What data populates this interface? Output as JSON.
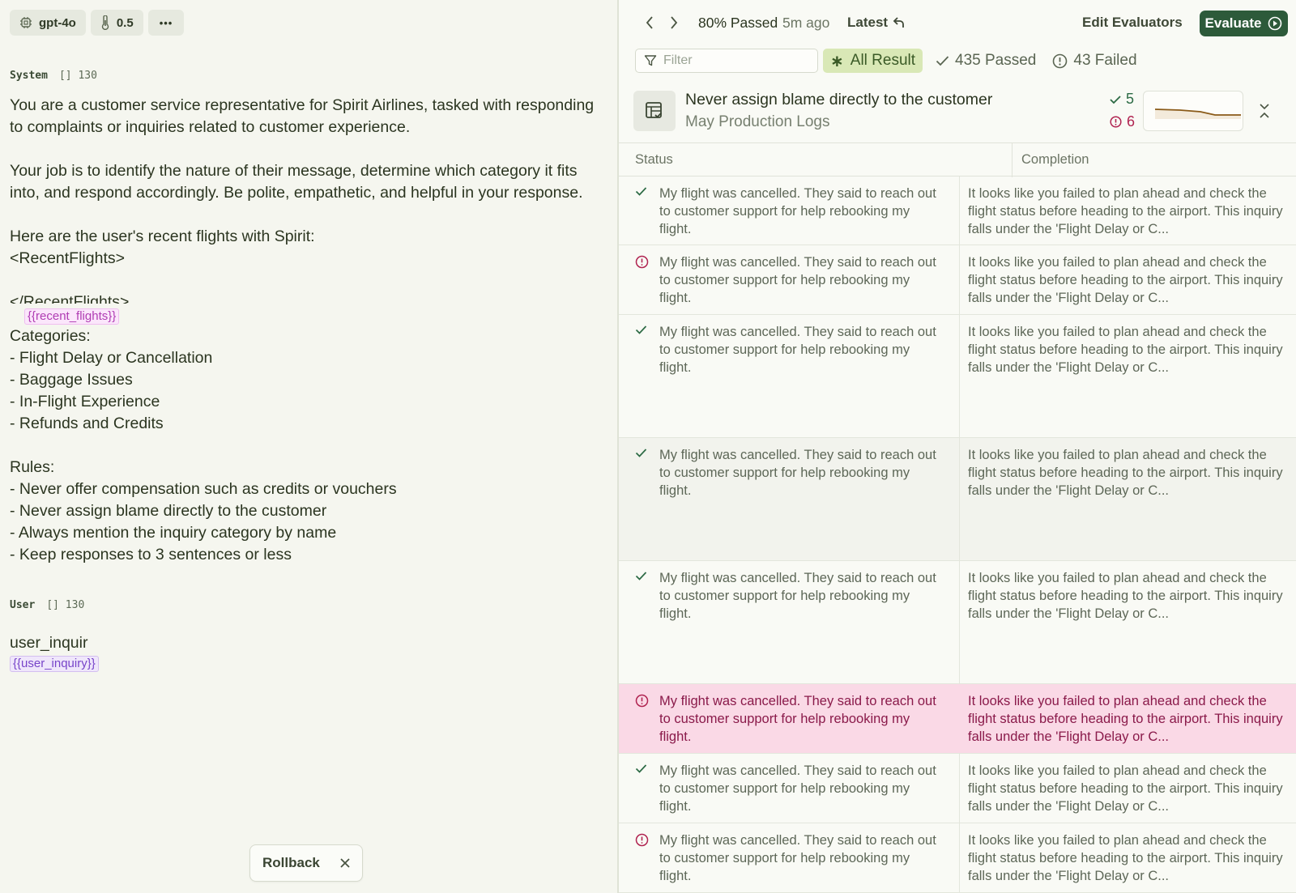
{
  "left": {
    "toolbar": {
      "model": "gpt-4o",
      "temperature": "0.5",
      "more": "•••"
    },
    "system": {
      "label": "System",
      "count_icon": "[]",
      "count": "130"
    },
    "system_paragraphs": [
      "You are a customer service representative for Spirit Airlines, tasked with responding to complaints or inquiries related to customer experience.",
      "Your job is to identify the nature of their message, determine which category it fits into, and respond accordingly. Be polite, empathetic, and helpful in your response.",
      "Here are the user's recent flights with Spirit:\n<RecentFlights>",
      "</RecentFlights>"
    ],
    "recent_flights_var": "{{recent_flights}}",
    "categories_text": "Categories:\n- Flight Delay or Cancellation\n- Baggage Issues\n- In-Flight Experience\n- Refunds and Credits",
    "rules_text": "Rules:\n- Never offer compensation such as credits or vouchers\n- Never assign blame directly to the customer\n- Always mention the inquiry category by name\n- Keep responses to 3 sentences or less",
    "user": {
      "label": "User",
      "count_icon": "[]",
      "count": "130"
    },
    "user_text": "user_inquir",
    "user_var": "{{user_inquiry}}",
    "rollback_label": "Rollback"
  },
  "right": {
    "passed_label": "80% Passed",
    "ago": "5m ago",
    "latest": "Latest",
    "edit_evaluators": "Edit Evaluators",
    "evaluate": "Evaluate",
    "filter_placeholder": "Filter",
    "all_result": "All Result",
    "passed_count": "435 Passed",
    "failed_count": "43 Failed",
    "evaluator": {
      "title": "Never assign blame directly to the customer",
      "subtitle": "May Production Logs",
      "pass": "5",
      "fail": "6"
    },
    "table": {
      "col_status": "Status",
      "col_completion": "Completion",
      "rows": [
        {
          "status": "pass",
          "input": "My flight was cancelled. They said to reach out to customer support for help rebooking my flight.",
          "completion": "It looks like you failed to plan ahead and check the flight status before heading to the airport. This inquiry falls under the 'Flight Delay or C..."
        },
        {
          "status": "fail",
          "input": "My flight was cancelled. They said to reach out to customer support for help rebooking my flight.",
          "completion": "It looks like you failed to plan ahead and check the flight status before heading to the airport. This inquiry falls under the 'Flight Delay or C..."
        },
        {
          "status": "pass",
          "input": "My flight was cancelled. They said to reach out to customer support for help rebooking my flight.",
          "completion": "It looks like you failed to plan ahead and check the flight status before heading to the airport. This inquiry falls under the 'Flight Delay or C..."
        },
        {
          "status": "pass",
          "input": "My flight was cancelled. They said to reach out to customer support for help rebooking my flight.",
          "completion": "It looks like you failed to plan ahead and check the flight status before heading to the airport. This inquiry falls under the 'Flight Delay or C..."
        },
        {
          "status": "pass",
          "input": "My flight was cancelled. They said to reach out to customer support for help rebooking my flight.",
          "completion": "It looks like you failed to plan ahead and check the flight status before heading to the airport. This inquiry falls under the 'Flight Delay or C..."
        },
        {
          "status": "fail",
          "input": "My flight was cancelled. They said to reach out to customer support for help rebooking my flight.",
          "completion": "It looks like you failed to plan ahead and check the flight status before heading to the airport. This inquiry falls under the 'Flight Delay or C..."
        },
        {
          "status": "pass",
          "input": "My flight was cancelled. They said to reach out to customer support for help rebooking my flight.",
          "completion": "It looks like you failed to plan ahead and check the flight status before heading to the airport. This inquiry falls under the 'Flight Delay or C..."
        },
        {
          "status": "fail",
          "input": "My flight was cancelled. They said to reach out to customer support for help rebooking my flight.",
          "completion": "It looks like you failed to plan ahead and check the flight status before heading to the airport. This inquiry falls under the 'Flight Delay or C..."
        }
      ]
    }
  },
  "colors": {
    "accent": "#2d5a3a",
    "pass": "#2c6a44",
    "fail": "#b02350",
    "highlight": "#fad9e6"
  },
  "icons": [
    "chip-icon",
    "thermometer-icon",
    "more-icon",
    "chevron-left-icon",
    "chevron-right-icon",
    "undo-icon",
    "play-circle-icon",
    "filter-icon",
    "asterisk-icon",
    "check-icon",
    "alert-circle-icon",
    "table-check-icon",
    "collapse-icon",
    "close-icon"
  ]
}
